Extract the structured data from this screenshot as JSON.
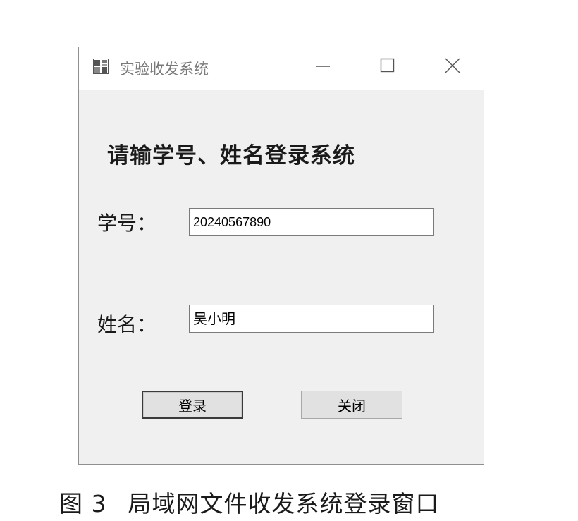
{
  "window": {
    "title": "实验收发系统",
    "icon": "app-window-icon",
    "controls": {
      "minimize": "minimize-icon",
      "maximize": "maximize-icon",
      "close": "close-icon"
    }
  },
  "form": {
    "heading": "请输学号、姓名登录系统",
    "student_id_label": "学号：",
    "student_id_value": "20240567890",
    "name_label": "姓名：",
    "name_value": "吴小明",
    "login_button": "登录",
    "close_button": "关闭"
  },
  "caption": {
    "figure_number": "图 3",
    "text": "局域网文件收发系统登录窗口"
  },
  "colors": {
    "window_bg": "#f0f0f0",
    "titlebar_bg": "#ffffff",
    "button_bg": "#e1e1e1"
  }
}
